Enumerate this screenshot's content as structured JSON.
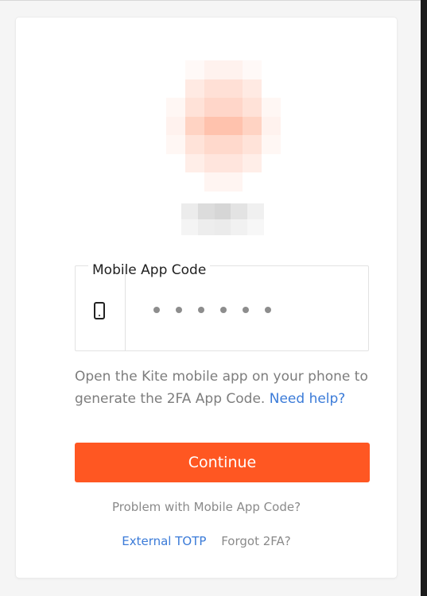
{
  "theme": {
    "accent": "#ff5722",
    "link": "#3b7bd8",
    "muted_text": "#7d7d7d"
  },
  "form": {
    "field_label": "Mobile App Code",
    "field_icon": "mobile-phone-icon",
    "code_value": "••••••",
    "help_text": "Open the Kite mobile app on your phone to generate the 2FA App Code.",
    "help_link": "Need help?",
    "continue_label": "Continue"
  },
  "footer": {
    "problem_text": "Problem with Mobile App Code?",
    "external_totp": "External TOTP",
    "forgot_2fa": "Forgot 2FA?"
  }
}
